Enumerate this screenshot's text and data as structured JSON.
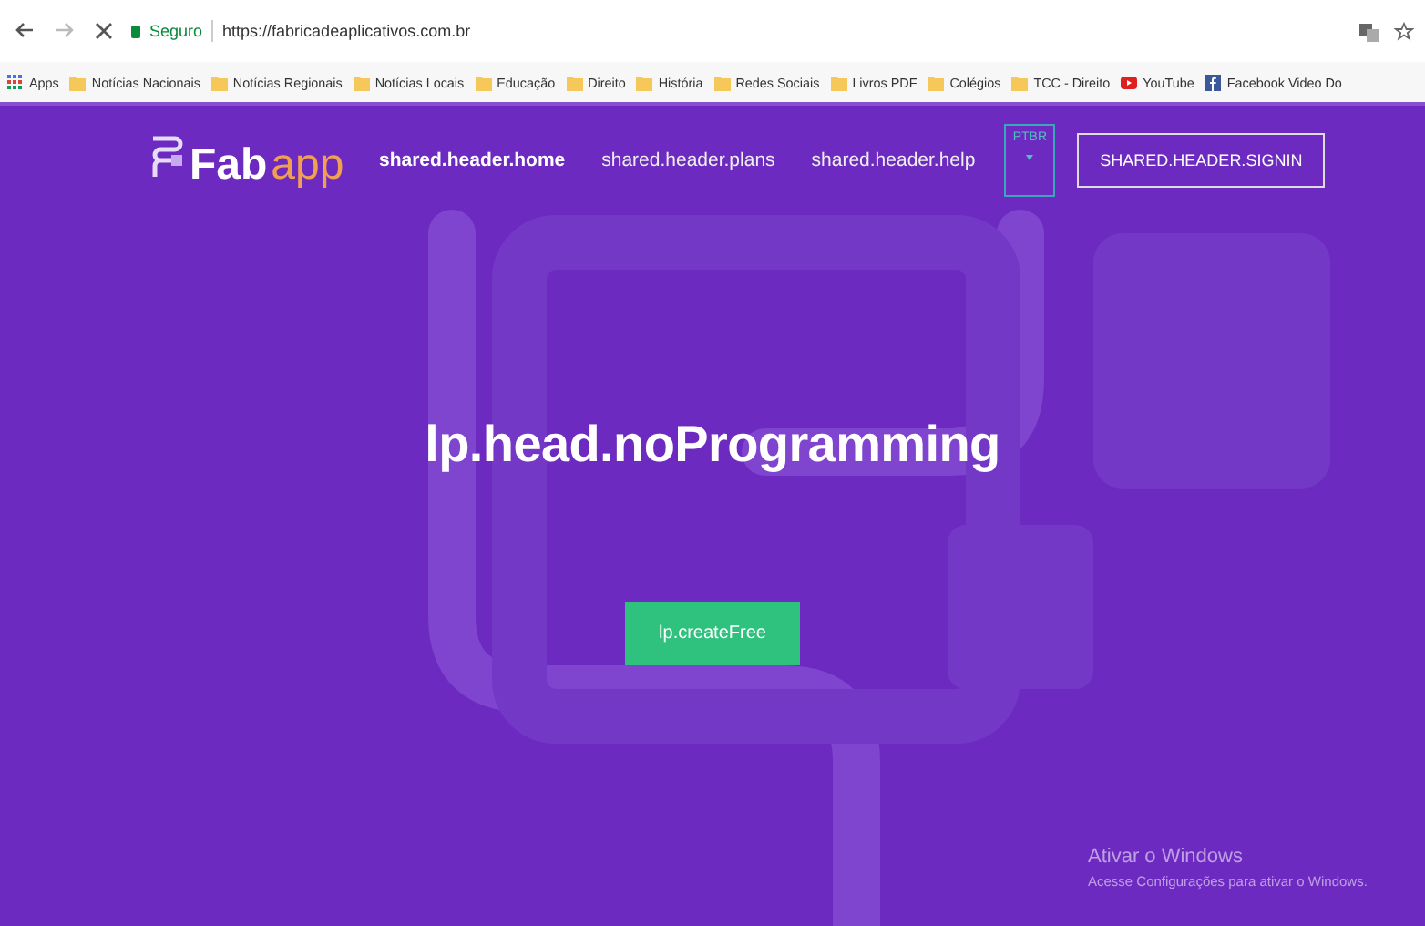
{
  "browser": {
    "address": {
      "secure_label": "Seguro",
      "url": "https://fabricadeaplicativos.com.br"
    },
    "bookmarks": [
      {
        "label": "Apps",
        "kind": "apps"
      },
      {
        "label": "Notícias Nacionais",
        "kind": "folder"
      },
      {
        "label": "Notícias Regionais",
        "kind": "folder"
      },
      {
        "label": "Notícias Locais",
        "kind": "folder"
      },
      {
        "label": "Educação",
        "kind": "folder"
      },
      {
        "label": "Direito",
        "kind": "folder"
      },
      {
        "label": "História",
        "kind": "folder"
      },
      {
        "label": "Redes Sociais",
        "kind": "folder"
      },
      {
        "label": "Livros PDF",
        "kind": "folder"
      },
      {
        "label": "Colégios",
        "kind": "folder"
      },
      {
        "label": "TCC - Direito",
        "kind": "folder"
      },
      {
        "label": "YouTube",
        "kind": "youtube"
      },
      {
        "label": "Facebook Video Do",
        "kind": "facebook"
      }
    ]
  },
  "header": {
    "logo": {
      "first": "Fab",
      "second": "app"
    },
    "nav": [
      {
        "label": "shared.header.home",
        "selected": true
      },
      {
        "label": "shared.header.plans",
        "selected": false
      },
      {
        "label": "shared.header.help",
        "selected": false
      }
    ],
    "language": {
      "label": "PTBR"
    },
    "signin": "SHARED.HEADER.SIGNIN"
  },
  "hero": {
    "title": "lp.head.noProgramming",
    "button": "lp.createFree"
  },
  "windows_notice": {
    "title": "Ativar o Windows",
    "body": "Acesse Configurações para ativar o Windows."
  }
}
